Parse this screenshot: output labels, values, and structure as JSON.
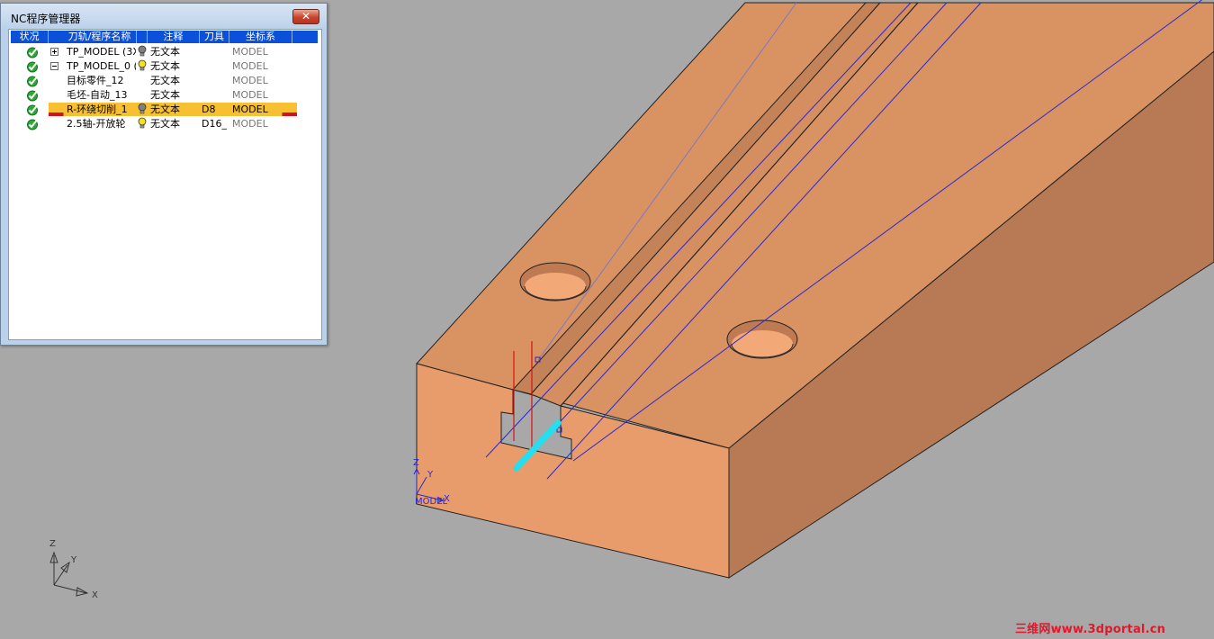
{
  "window": {
    "title": "NC程序管理器",
    "close_symbol": "✕"
  },
  "columns": [
    "状况",
    "刀轨/程序名称",
    "注释",
    "刀具",
    "坐标系"
  ],
  "rows": [
    {
      "status": "complete",
      "expander": "plus",
      "name": "TP_MODEL (3X",
      "bulb": "gray",
      "note": "无文本",
      "tool": "",
      "coord": "MODEL",
      "selected": false
    },
    {
      "status": "complete",
      "expander": "minus",
      "name": "TP_MODEL_0 (",
      "bulb": "yellow",
      "note": "无文本",
      "tool": "",
      "coord": "MODEL",
      "selected": false
    },
    {
      "status": "complete",
      "expander": "",
      "name": "目标零件_12",
      "bulb": "",
      "note": "无文本",
      "tool": "",
      "coord": "MODEL",
      "selected": false
    },
    {
      "status": "complete",
      "expander": "",
      "name": "毛坯-自动_13",
      "bulb": "",
      "note": "无文本",
      "tool": "",
      "coord": "MODEL",
      "selected": false
    },
    {
      "status": "complete",
      "expander": "",
      "name": "R-环绕切削_1",
      "bulb": "gray",
      "note": "无文本",
      "tool": "D8",
      "coord": "MODEL",
      "selected": true
    },
    {
      "status": "complete",
      "expander": "",
      "name": "2.5轴-开放轮",
      "bulb": "yellow",
      "note": "无文本",
      "tool": "D16_",
      "coord": "MODEL",
      "selected": false
    }
  ],
  "viewport": {
    "background_color": "#a8a8a8",
    "part_colors": {
      "top": "#d99262",
      "front": "#e89c6c",
      "right": "#b87a55"
    },
    "toolpath_color": "#2a2ad0",
    "tool_color": "#e01010",
    "highlight_color": "#22e0f0",
    "world_axes": {
      "x": "X",
      "y": "Y",
      "z": "Z"
    },
    "local_axes": {
      "x": "X",
      "y": "Y",
      "z": "Z",
      "label": "MODEL"
    }
  },
  "watermark": "三维网www.3dportal.cn"
}
